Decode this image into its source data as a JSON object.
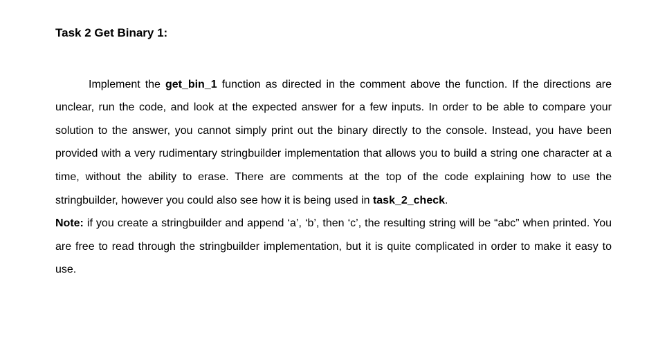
{
  "title": "Task 2 Get Binary 1:",
  "p1_a": "Implement the ",
  "p1_fn": "get_bin_1",
  "p1_b": " function as directed in the comment above the function. If the directions are unclear, run the code, and look at the expected answer for a few inputs. In order to be able to compare your solution to the answer, you cannot simply print out the binary directly to the console. Instead, you have been provided with a very rudimentary stringbuilder implementation that allows you to build a string one character at a time, without the ability to erase. There are comments at the top of the code explaining how to use the stringbuilder, however you could also see how it is being used in ",
  "p1_check": "task_2_check",
  "p1_c": ".",
  "note_label": "Note:",
  "note_body": " if you create a stringbuilder and append ‘a’, ‘b’, then ‘c’, the resulting string will be “abc” when printed. You are free to read through the stringbuilder implementation, but it is quite complicated in order to make it easy to use."
}
